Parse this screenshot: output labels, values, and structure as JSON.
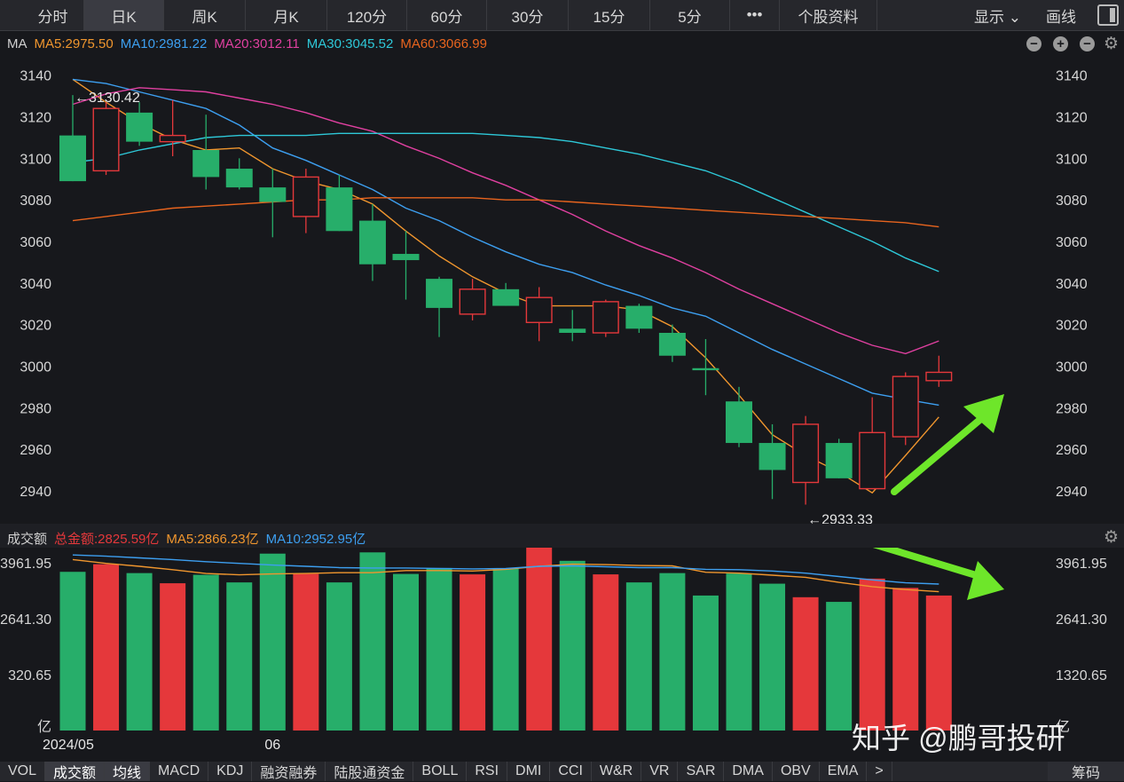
{
  "topbar": {
    "tabs": [
      "分时",
      "日K",
      "周K",
      "月K",
      "120分",
      "60分",
      "30分",
      "15分",
      "5分",
      "•••",
      "个股资料"
    ],
    "active_tab": "日K",
    "display_label": "显示",
    "draw_label": "画线"
  },
  "main_legend": {
    "indicator": "MA",
    "items": [
      {
        "text": "MA5:2975.50",
        "color": "#f0962e"
      },
      {
        "text": "MA10:2981.22",
        "color": "#3d9ff0"
      },
      {
        "text": "MA20:3012.11",
        "color": "#e040a0"
      },
      {
        "text": "MA30:3045.52",
        "color": "#2ec8d8"
      },
      {
        "text": "MA60:3066.99",
        "color": "#e8641e"
      }
    ]
  },
  "volume_legend": {
    "title": "成交额",
    "items": [
      {
        "text": "总金额:2825.59亿",
        "color": "#e5383b"
      },
      {
        "text": "MA5:2866.23亿",
        "color": "#f0962e"
      },
      {
        "text": "MA10:2952.95亿",
        "color": "#3d9ff0"
      }
    ]
  },
  "colors": {
    "up": "#e5383b",
    "down": "#27ae6a",
    "arrow": "#6ee62a",
    "bg": "#17181c"
  },
  "chart_data": [
    {
      "type": "candlestick",
      "y_ticks": [
        3140,
        3120,
        3100,
        3080,
        3060,
        3040,
        3020,
        3000,
        2980,
        2960,
        2940
      ],
      "ylim": [
        2925,
        3148
      ],
      "annotations": [
        {
          "text": "←3130.42",
          "candle": 0,
          "value": 3130.42
        },
        {
          "text": "←2933.33",
          "candle": 22,
          "value": 2933.33
        }
      ],
      "candles": [
        {
          "o": 3111,
          "c": 3089,
          "h": 3130.42,
          "l": 3089
        },
        {
          "o": 3094,
          "c": 3124,
          "h": 3127,
          "l": 3092
        },
        {
          "o": 3122,
          "c": 3108,
          "h": 3127,
          "l": 3106
        },
        {
          "o": 3108,
          "c": 3111,
          "h": 3128,
          "l": 3101
        },
        {
          "o": 3104,
          "c": 3091,
          "h": 3121,
          "l": 3085
        },
        {
          "o": 3095,
          "c": 3086,
          "h": 3100,
          "l": 3085
        },
        {
          "o": 3086,
          "c": 3079,
          "h": 3095,
          "l": 3062
        },
        {
          "o": 3072,
          "c": 3091,
          "h": 3095,
          "l": 3064
        },
        {
          "o": 3086,
          "c": 3065,
          "h": 3092,
          "l": 3065
        },
        {
          "o": 3070,
          "c": 3049,
          "h": 3078,
          "l": 3041
        },
        {
          "o": 3054,
          "c": 3051,
          "h": 3065,
          "l": 3032
        },
        {
          "o": 3042,
          "c": 3028,
          "h": 3043,
          "l": 3014
        },
        {
          "o": 3025,
          "c": 3037,
          "h": 3042,
          "l": 3022
        },
        {
          "o": 3037,
          "c": 3029,
          "h": 3040,
          "l": 3029
        },
        {
          "o": 3021,
          "c": 3033,
          "h": 3038,
          "l": 3012
        },
        {
          "o": 3018,
          "c": 3016,
          "h": 3027,
          "l": 3012
        },
        {
          "o": 3016,
          "c": 3031,
          "h": 3032,
          "l": 3014
        },
        {
          "o": 3029,
          "c": 3018,
          "h": 3030,
          "l": 3016
        },
        {
          "o": 3016,
          "c": 3005,
          "h": 3020,
          "l": 3002
        },
        {
          "o": 2999,
          "c": 2998,
          "h": 3013,
          "l": 2986
        },
        {
          "o": 2983,
          "c": 2963,
          "h": 2990,
          "l": 2961
        },
        {
          "o": 2963,
          "c": 2950,
          "h": 2972,
          "l": 2936
        },
        {
          "o": 2944,
          "c": 2972,
          "h": 2976,
          "l": 2933.33
        },
        {
          "o": 2963,
          "c": 2946,
          "h": 2965,
          "l": 2946
        },
        {
          "o": 2941,
          "c": 2968,
          "h": 2985,
          "l": 2941
        },
        {
          "o": 2966,
          "c": 2995,
          "h": 2997,
          "l": 2962
        },
        {
          "o": 2993,
          "c": 2997,
          "h": 3005,
          "l": 2990
        }
      ],
      "series": [
        {
          "name": "MA5",
          "color": "#f0962e",
          "values": [
            3138,
            3127,
            3117,
            3109,
            3104,
            3105,
            3095,
            3089,
            3085,
            3078,
            3065,
            3053,
            3043,
            3035,
            3029,
            3029,
            3029,
            3027,
            3019,
            3004,
            2986,
            2967,
            2957,
            2949,
            2939,
            2957,
            2975.5
          ]
        },
        {
          "name": "MA10",
          "color": "#3d9ff0",
          "values": [
            3138,
            3136,
            3132,
            3128,
            3124,
            3116,
            3105,
            3099,
            3092,
            3085,
            3076,
            3070,
            3062,
            3055,
            3049,
            3045,
            3039,
            3034,
            3028,
            3024,
            3016,
            3008,
            3001,
            2994,
            2987,
            2984,
            2981.22
          ]
        },
        {
          "name": "MA20",
          "color": "#e040a0",
          "values": [
            3126,
            3131,
            3134,
            3133,
            3132,
            3129,
            3126,
            3122,
            3117,
            3113,
            3106,
            3100,
            3093,
            3087,
            3080,
            3073,
            3065,
            3058,
            3052,
            3045,
            3037,
            3030,
            3023,
            3016,
            3010,
            3006,
            3012.11
          ]
        },
        {
          "name": "MA30",
          "color": "#2ec8d8",
          "values": [
            3098,
            3100,
            3104,
            3107,
            3110,
            3111,
            3111,
            3111,
            3112,
            3112,
            3112,
            3112,
            3112,
            3111,
            3110,
            3108,
            3105,
            3102,
            3098,
            3094,
            3088,
            3081,
            3074,
            3067,
            3060,
            3052,
            3045.52
          ]
        },
        {
          "name": "MA60",
          "color": "#e8641e",
          "values": [
            3070,
            3072,
            3074,
            3076,
            3077,
            3078,
            3079,
            3080,
            3080,
            3081,
            3081,
            3081,
            3081,
            3080,
            3080,
            3079,
            3078,
            3077,
            3076,
            3075,
            3074,
            3073,
            3072,
            3071,
            3070,
            3069,
            3066.99
          ]
        }
      ]
    },
    {
      "type": "bar",
      "y_ticks": [
        {
          "label": "3961.95",
          "value": 3961.95
        },
        {
          "label": "2641.30",
          "value": 2641.3
        },
        {
          "label": "320.65",
          "value": 1320.65
        },
        {
          "label": "亿",
          "value": 0
        }
      ],
      "y_ticks_right": [
        {
          "label": "3961.95",
          "value": 3961.95
        },
        {
          "label": "2641.30",
          "value": 2641.3
        },
        {
          "label": "1320.65",
          "value": 1320.65
        },
        {
          "label": "亿",
          "value": 0
        }
      ],
      "ylim": [
        0,
        4300
      ],
      "x_labels": [
        {
          "label": "2024/05",
          "index": 0
        },
        {
          "label": "06",
          "index": 6
        }
      ],
      "values": [
        3750,
        3930,
        3720,
        3480,
        3680,
        3500,
        4180,
        3700,
        3500,
        4210,
        3700,
        3840,
        3690,
        3830,
        4340,
        4010,
        3690,
        3500,
        3720,
        3190,
        3710,
        3470,
        3150,
        3040,
        3590,
        3370,
        3190
      ],
      "series": [
        {
          "name": "MA5",
          "color": "#f0962e",
          "values": [
            4040,
            3950,
            3880,
            3800,
            3710,
            3680,
            3700,
            3710,
            3730,
            3730,
            3780,
            3780,
            3770,
            3810,
            3880,
            3930,
            3920,
            3900,
            3890,
            3740,
            3720,
            3670,
            3620,
            3500,
            3400,
            3330,
            3280
          ]
        },
        {
          "name": "MA10",
          "color": "#3d9ff0",
          "values": [
            4150,
            4120,
            4080,
            4040,
            3990,
            3950,
            3910,
            3880,
            3850,
            3840,
            3840,
            3830,
            3820,
            3830,
            3880,
            3890,
            3870,
            3850,
            3850,
            3810,
            3800,
            3770,
            3720,
            3640,
            3560,
            3490,
            3460
          ]
        }
      ]
    }
  ],
  "bottombar": {
    "tabs": [
      "VOL",
      "成交额",
      "均线",
      "MACD",
      "KDJ",
      "融资融券",
      "陆股通资金",
      "BOLL",
      "RSI",
      "DMI",
      "CCI",
      "W&R",
      "VR",
      "SAR",
      "DMA",
      "OBV",
      "EMA",
      ">"
    ],
    "active": [
      "成交额",
      "均线"
    ],
    "right_chip": "筹码"
  },
  "watermark": "知乎 @鹏哥投研"
}
